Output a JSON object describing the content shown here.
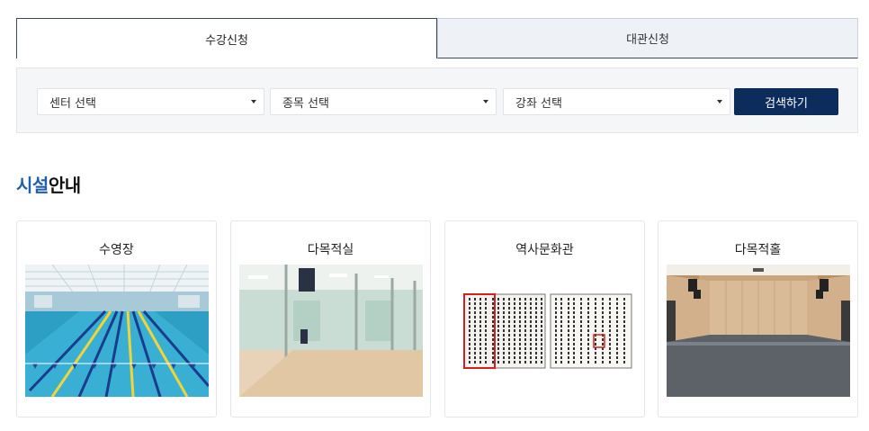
{
  "tabs": [
    {
      "label": "수강신청",
      "active": true
    },
    {
      "label": "대관신청",
      "active": false
    }
  ],
  "search": {
    "center_select": "센터 선택",
    "sport_select": "종목 선택",
    "course_select": "강좌 선택",
    "search_button": "검색하기"
  },
  "section": {
    "title_accent": "시설",
    "title_rest": "안내"
  },
  "facilities": [
    {
      "name": "수영장",
      "image": "swimming-pool-photo"
    },
    {
      "name": "다목적실",
      "image": "multipurpose-room-photo"
    },
    {
      "name": "역사문화관",
      "image": "historical-document-photo"
    },
    {
      "name": "다목적홀",
      "image": "multipurpose-hall-photo"
    }
  ],
  "colors": {
    "accent": "#1f5fae",
    "button": "#0c2c5c",
    "tab_border": "#3a4a63",
    "inactive_tab_bg": "#eef2f7"
  }
}
